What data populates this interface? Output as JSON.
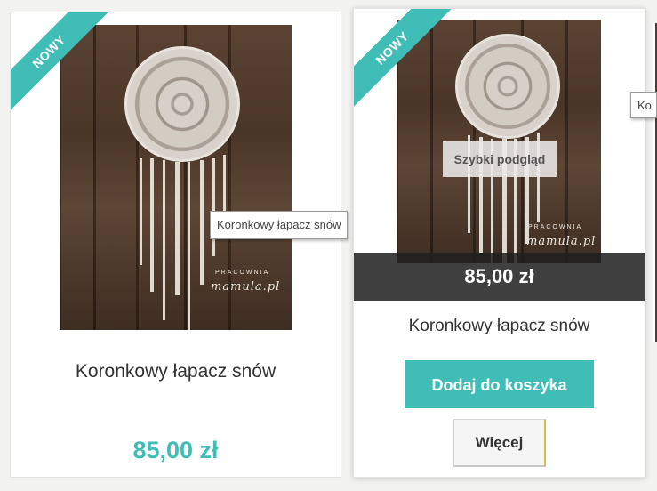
{
  "products": [
    {
      "badge": "NOWY",
      "name": "Koronkowy łapacz snów",
      "price": "85,00 zł",
      "watermark_small": "PRACOWNIA",
      "watermark": "mamula.pl",
      "tooltip": "Koronkowy łapacz snów"
    },
    {
      "badge": "NOWY",
      "name": "Koronkowy łapacz snów",
      "price": "85,00 zł",
      "quick_view_label": "Szybki podgląd",
      "add_to_cart_label": "Dodaj do koszyka",
      "more_label": "Więcej",
      "watermark_small": "PRACOWNIA",
      "watermark": "mamula.pl"
    }
  ],
  "partial_tooltip": "Ko",
  "colors": {
    "accent": "#3fbdb6",
    "price_bar": "#1e1e1e",
    "text": "#333333"
  }
}
